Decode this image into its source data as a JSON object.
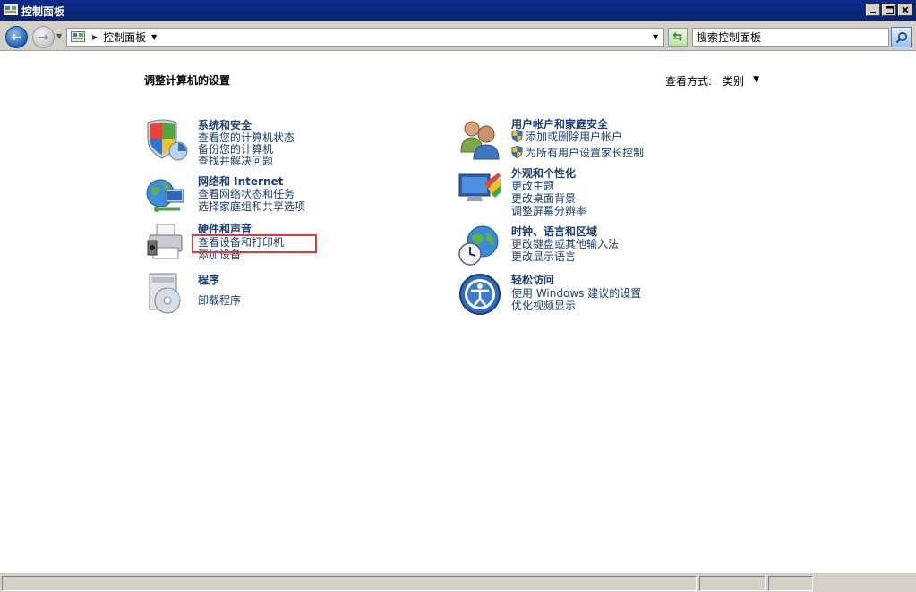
{
  "window": {
    "title": "控制面板",
    "icon": "control-panel-icon"
  },
  "toolbar": {
    "breadcrumb": "控制面板",
    "search_placeholder": "搜索控制面板"
  },
  "main": {
    "heading": "调整计算机的设置",
    "view_by_label": "查看方式:",
    "view_by_value": "类别"
  },
  "categories": {
    "system": {
      "title": "系统和安全",
      "icon": "shield-icon",
      "links": [
        "查看您的计算机状态",
        "备份您的计算机",
        "查找并解决问题"
      ]
    },
    "network": {
      "title": "网络和 Internet",
      "icon": "network-globe-icon",
      "links": [
        "查看网络状态和任务",
        "选择家庭组和共享选项"
      ]
    },
    "hardware": {
      "title": "硬件和声音",
      "icon": "printer-icon",
      "links": [
        "查看设备和打印机",
        "添加设备"
      ]
    },
    "programs": {
      "title": "程序",
      "icon": "programs-disc-icon",
      "links": [
        "卸载程序"
      ]
    },
    "users": {
      "title": "用户帐户和家庭安全",
      "icon": "users-icon",
      "links": [
        "添加或删除用户帐户",
        "为所有用户设置家长控制"
      ]
    },
    "appearance": {
      "title": "外观和个性化",
      "icon": "monitor-paint-icon",
      "links": [
        "更改主题",
        "更改桌面背景",
        "调整屏幕分辨率"
      ]
    },
    "clock": {
      "title": "时钟、语言和区域",
      "icon": "clock-globe-icon",
      "links": [
        "更改键盘或其他输入法",
        "更改显示语言"
      ]
    },
    "ease": {
      "title": "轻松访问",
      "icon": "ease-of-access-icon",
      "links": [
        "使用 Windows 建议的设置",
        "优化视频显示"
      ]
    }
  },
  "colors": {
    "link": "#1b3f73",
    "highlight_box": "#e53935",
    "titlebar": "#0a246a"
  }
}
